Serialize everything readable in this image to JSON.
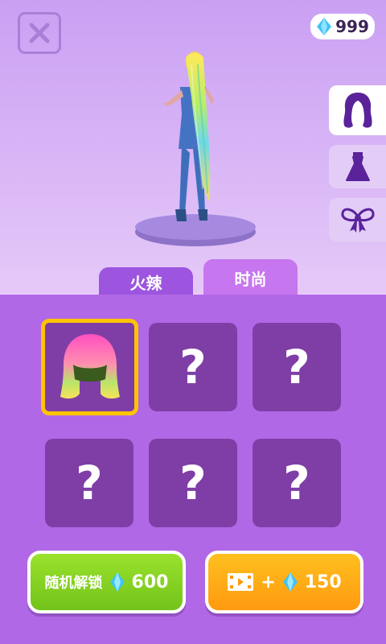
{
  "header": {
    "gem_count": "999"
  },
  "side_tabs": [
    {
      "name": "hair",
      "active": true
    },
    {
      "name": "dress",
      "active": false
    },
    {
      "name": "bow",
      "active": false
    }
  ],
  "tabs": [
    {
      "label": "火辣"
    },
    {
      "label": "时尚"
    }
  ],
  "grid": {
    "slots": [
      {
        "state": "unlocked",
        "item": "hair"
      },
      {
        "state": "locked",
        "label": "?"
      },
      {
        "state": "locked",
        "label": "?"
      },
      {
        "state": "locked",
        "label": "?"
      },
      {
        "state": "locked",
        "label": "?"
      },
      {
        "state": "locked",
        "label": "?"
      }
    ]
  },
  "buttons": {
    "random_unlock_label": "随机解锁",
    "random_unlock_cost": "600",
    "video_plus": "+",
    "video_reward": "150"
  },
  "colors": {
    "gem": "#3fc3f5",
    "accent_tab": "#9d55df",
    "active_tab": "#c676ef",
    "slot_bg": "#7f3ea6",
    "selected_border": "#ffc400",
    "green_button": "#87d222",
    "orange_button": "#ffaa15"
  }
}
